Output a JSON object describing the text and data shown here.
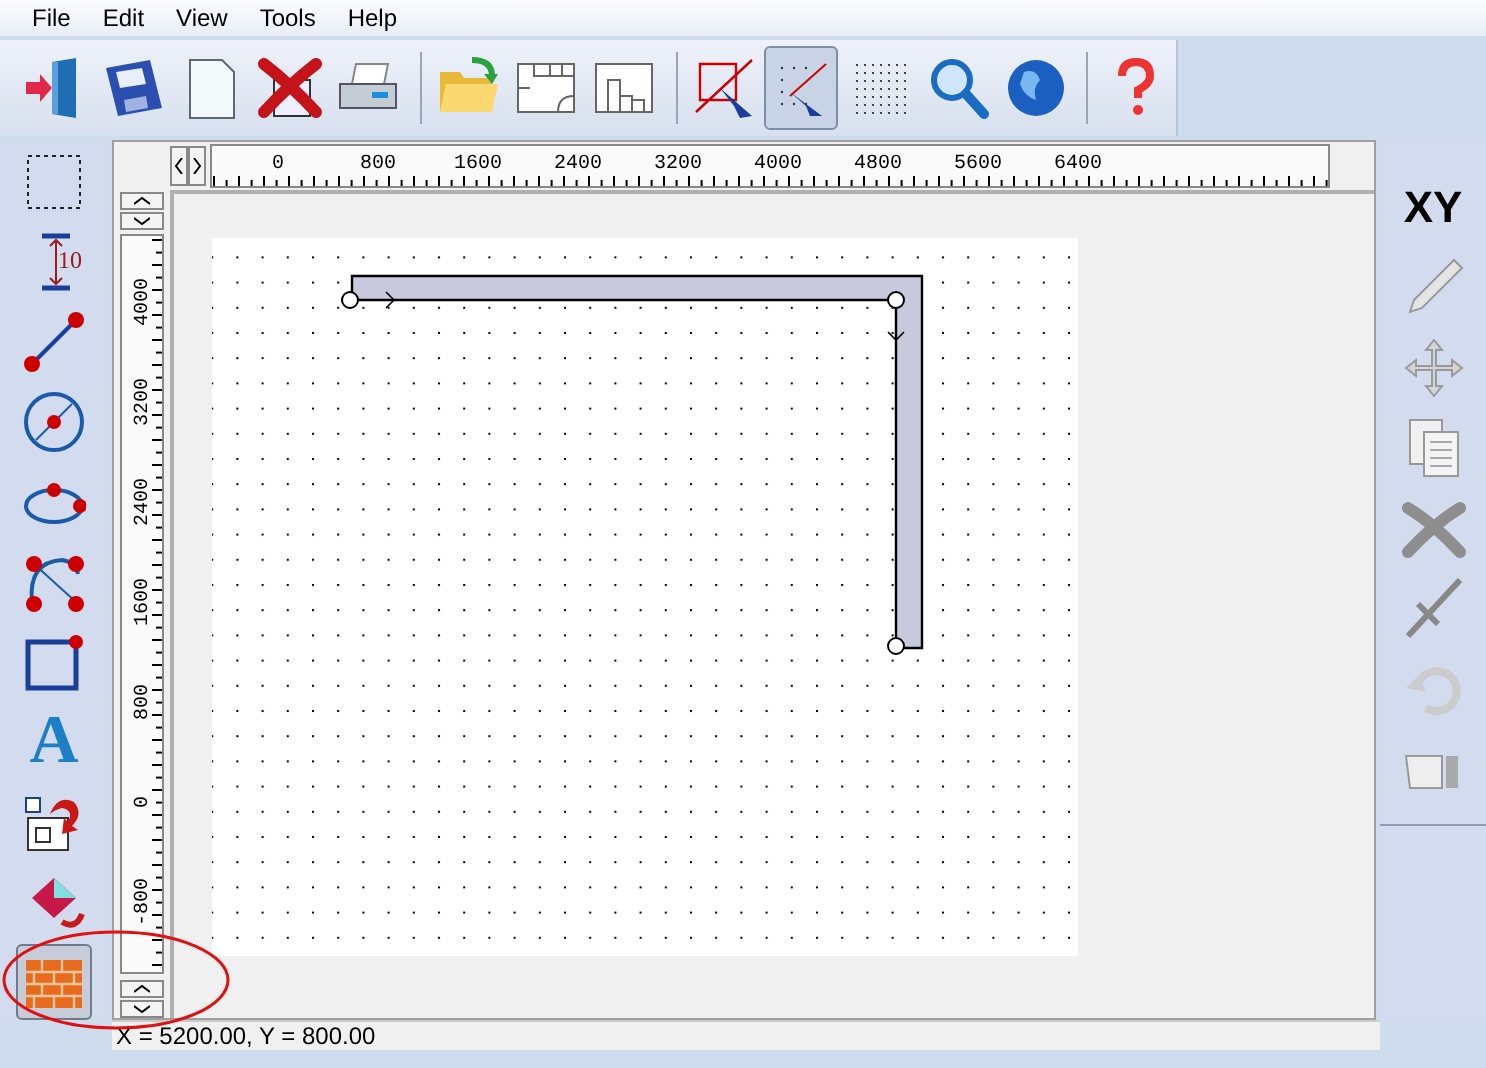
{
  "menu": [
    "File",
    "Edit",
    "View",
    "Tools",
    "Help"
  ],
  "toolbar": [
    {
      "kind": "exit",
      "selected": false
    },
    {
      "kind": "save",
      "selected": false
    },
    {
      "kind": "new",
      "selected": false
    },
    {
      "kind": "delete",
      "selected": false
    },
    {
      "kind": "print",
      "selected": false
    },
    {
      "kind": "separator"
    },
    {
      "kind": "open",
      "selected": false
    },
    {
      "kind": "plan",
      "selected": false
    },
    {
      "kind": "rooms",
      "selected": false
    },
    {
      "kind": "separator"
    },
    {
      "kind": "node-select",
      "selected": false
    },
    {
      "kind": "snap",
      "selected": true
    },
    {
      "kind": "grid",
      "selected": false
    },
    {
      "kind": "zoom",
      "selected": false
    },
    {
      "kind": "globe",
      "selected": false
    },
    {
      "kind": "separator"
    },
    {
      "kind": "help",
      "selected": false
    }
  ],
  "tools_left": [
    {
      "kind": "select",
      "selected": false
    },
    {
      "kind": "dimension",
      "label": "10",
      "selected": false
    },
    {
      "kind": "line",
      "selected": false
    },
    {
      "kind": "circle",
      "selected": false
    },
    {
      "kind": "ellipse",
      "selected": false
    },
    {
      "kind": "arc",
      "selected": false
    },
    {
      "kind": "rect",
      "selected": false
    },
    {
      "kind": "text",
      "label": "A",
      "selected": false
    },
    {
      "kind": "group",
      "selected": false
    },
    {
      "kind": "fill",
      "selected": false
    },
    {
      "kind": "wall",
      "selected": true
    }
  ],
  "tools_right": [
    {
      "kind": "xy",
      "label": "XY",
      "disabled": false
    },
    {
      "kind": "pencil",
      "disabled": true
    },
    {
      "kind": "move",
      "disabled": true
    },
    {
      "kind": "copy",
      "disabled": true
    },
    {
      "kind": "delete",
      "disabled": true
    },
    {
      "kind": "split",
      "disabled": true
    },
    {
      "kind": "rotate",
      "disabled": true
    },
    {
      "kind": "hand",
      "disabled": true
    }
  ],
  "ruler_x": {
    "labels": [
      "0",
      "800",
      "1600",
      "2400",
      "3200",
      "4000",
      "4800",
      "5600",
      "6400"
    ]
  },
  "ruler_y": {
    "labels": [
      "4000",
      "3200",
      "2400",
      "1600",
      "800",
      "0",
      "-800"
    ]
  },
  "status_bar": {
    "text": "X = 5200.00, Y = 800.00"
  }
}
